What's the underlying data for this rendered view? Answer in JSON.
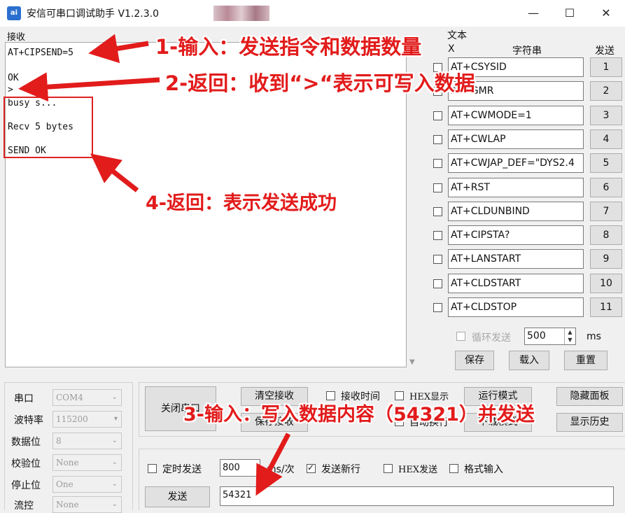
{
  "window": {
    "title": "安信可串口调试助手 V1.2.3.0",
    "app_icon_text": "ai",
    "minimize": "—",
    "maximize": "☐",
    "close": "✕"
  },
  "receive": {
    "label": "接收",
    "lines": [
      "AT+CIPSEND=5",
      "",
      "OK",
      ">",
      "busy s...",
      "",
      "Recv 5 bytes",
      "",
      "SEND OK"
    ]
  },
  "multi_text": {
    "title": "文本",
    "col_x": "X",
    "col_string": "字符串",
    "col_send": "发送",
    "rows": [
      {
        "text": "AT+CSYSID",
        "btn": "1"
      },
      {
        "text": "AT+GMR",
        "btn": "2"
      },
      {
        "text": "AT+CWMODE=1",
        "btn": "3"
      },
      {
        "text": "AT+CWLAP",
        "btn": "4"
      },
      {
        "text": "AT+CWJAP_DEF=\"DYS2.4",
        "btn": "5"
      },
      {
        "text": "AT+RST",
        "btn": "6"
      },
      {
        "text": "AT+CLDUNBIND",
        "btn": "7"
      },
      {
        "text": "AT+CIPSTA?",
        "btn": "8"
      },
      {
        "text": "AT+LANSTART",
        "btn": "9"
      },
      {
        "text": "AT+CLDSTART",
        "btn": "10"
      },
      {
        "text": "AT+CLDSTOP",
        "btn": "11"
      }
    ],
    "loop_send_label": "循环发送",
    "loop_interval": "500",
    "loop_unit": "ms",
    "save_label": "保存",
    "load_label": "载入",
    "reset_label": "重置"
  },
  "serial": {
    "port_label": "串口",
    "port_value": "COM4",
    "baud_label": "波特率",
    "baud_value": "115200",
    "databits_label": "数据位",
    "databits_value": "8",
    "parity_label": "校验位",
    "parity_value": "None",
    "stopbits_label": "停止位",
    "stopbits_value": "One",
    "flow_label": "流控",
    "flow_value": "None"
  },
  "controls": {
    "close_port": "关闭串口",
    "clear_receive": "清空接收",
    "save_receive": "保存接收",
    "receive_time": "接收时间",
    "hex_display": "HEX显示",
    "auto_newline": "自动换行",
    "run_mode": "运行模式",
    "download_mode": "下载模式",
    "hide_panel": "隐藏面板",
    "show_history": "显示历史"
  },
  "send": {
    "timed_send_label": "定时发送",
    "interval_value": "800",
    "interval_unit": "ms/次",
    "send_newline_label": "发送新行",
    "hex_send_label": "HEX发送",
    "format_input_label": "格式输入",
    "send_button": "发送",
    "send_text": "54321"
  },
  "annotations": {
    "a1": "1-输入：发送指令和数据数量",
    "a2": "2-返回：收到“>“表示可写入数据",
    "a3": "3-输入：写入数据内容（54321）并发送",
    "a4": "4-返回：表示发送成功",
    "color": "#e21b1b"
  }
}
